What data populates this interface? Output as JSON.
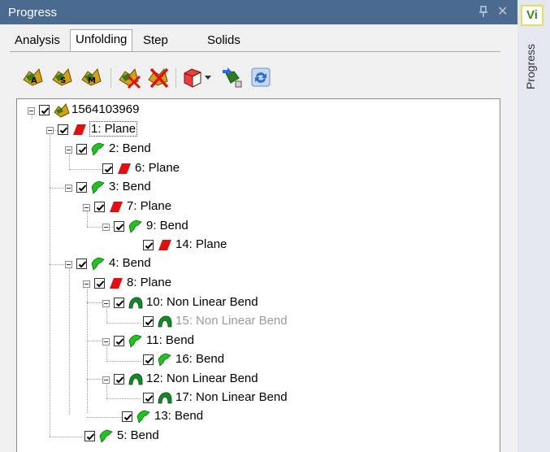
{
  "window": {
    "title": "Progress"
  },
  "tabs": [
    {
      "label": "Analysis"
    },
    {
      "label": "Unfolding"
    },
    {
      "label": "Step"
    },
    {
      "label": "Solids"
    }
  ],
  "side_panel": {
    "badge": "Vi",
    "label": "Progress"
  },
  "tree": {
    "root": "1564103969",
    "nodes": [
      {
        "label": "1: Plane"
      },
      {
        "label": "2: Bend"
      },
      {
        "label": "6: Plane"
      },
      {
        "label": "3: Bend"
      },
      {
        "label": "7: Plane"
      },
      {
        "label": "9: Bend"
      },
      {
        "label": "14: Plane"
      },
      {
        "label": "4: Bend"
      },
      {
        "label": "8: Plane"
      },
      {
        "label": "10: Non Linear Bend"
      },
      {
        "label": "15: Non Linear Bend"
      },
      {
        "label": "11: Bend"
      },
      {
        "label": "16: Bend"
      },
      {
        "label": "12: Non Linear Bend"
      },
      {
        "label": "17: Non Linear Bend"
      },
      {
        "label": "13: Bend"
      },
      {
        "label": "5: Bend"
      }
    ]
  },
  "colors": {
    "titlebar": "#4a6a8f",
    "plane": "#e01010",
    "bend": "#22c022",
    "nonlinear": "#128a28"
  }
}
